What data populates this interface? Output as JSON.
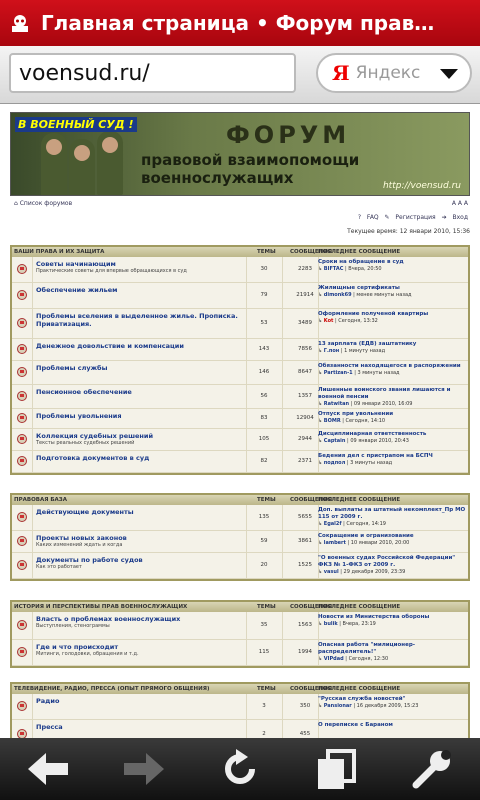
{
  "browser": {
    "tab_title": "Главная страница • Форум прав…",
    "url": "voensud.ru/",
    "search_logo": "Я",
    "search_engine": "Яндекс"
  },
  "banner": {
    "badge": "В ВОЕННЫЙ СУД !",
    "title": "ФОРУМ",
    "subtitle": "правовой взаимопомощи военнослужащих",
    "url": "http://voensud.ru"
  },
  "nav": {
    "index_link": "Список форумов",
    "aa": "A A A",
    "faq": "FAQ",
    "register": "Регистрация",
    "login": "Вход",
    "time": "Текущее время: 12 январи 2010, 15:36"
  },
  "cols": {
    "topics": "ТЕМЫ",
    "posts": "СООБЩЕНИЯ",
    "last": "ПОСЛЕДНЕЕ СООБЩЕНИЕ"
  },
  "categories": [
    {
      "name": "ВАШИ ПРАВА И ИХ ЗАЩИТА",
      "forums": [
        {
          "name": "Советы начинающим",
          "desc": "Практические советы для впервые обращающихся в суд",
          "topics": "30",
          "posts": "2283",
          "lt": "Сроки на обращение в суд",
          "lb_user": "BIFTAC",
          "lb_time": " | Вчера, 20:50"
        },
        {
          "name": "Обеспечение жильем",
          "desc": "",
          "topics": "79",
          "posts": "21914",
          "lt": "Жилищные сертификаты",
          "lb_user": "dimonk69",
          "lb_time": " | менее минуты назад"
        },
        {
          "name": "Проблемы вселения в выделенное жилье. Прописка. Приватизация.",
          "desc": "",
          "topics": "53",
          "posts": "3489",
          "lt": "Оформление полученой квартиры",
          "lb_user": "Kot",
          "lb_time": " | Сегодня, 13:32",
          "red": true
        },
        {
          "name": "Денежное довольствие и компенсации",
          "desc": "",
          "topics": "143",
          "posts": "7856",
          "lt": "13 зарплата (ЕДВ) заштатнику",
          "lb_user": "Г.пон",
          "lb_time": " | 1 минуту назад"
        },
        {
          "name": "Проблемы службы",
          "desc": "",
          "topics": "146",
          "posts": "8647",
          "lt": "Обязанности находящегося в распоряжении",
          "lb_user": "Partizan-1",
          "lb_time": " | 3 минуты назад"
        },
        {
          "name": "Пенсионное обеспечение",
          "desc": "",
          "topics": "56",
          "posts": "1357",
          "lt": "Лишенные воинского звания лишаются и военной пенсии",
          "lb_user": "Ratwitan",
          "lb_time": " | 09 январи 2010, 16:09"
        },
        {
          "name": "Проблемы увольнения",
          "desc": "",
          "topics": "83",
          "posts": "12904",
          "lt": "Отпуск при увольнении",
          "lb_user": "BOMR",
          "lb_time": " | Сегодня, 14:10"
        },
        {
          "name": "Коллекция судебных решений",
          "desc": "Тексты реальных судебных решений",
          "topics": "105",
          "posts": "2944",
          "lt": "Дисциплинарная ответственность",
          "lb_user": "Captain",
          "lb_time": " | 09 январи 2010, 20:43"
        },
        {
          "name": "Подготовка документов в суд",
          "desc": "",
          "topics": "82",
          "posts": "2371",
          "lt": "Бедения дел с пристрапом на БСПЧ",
          "lb_user": "подпол",
          "lb_time": " | 3 минуты назад"
        }
      ]
    },
    {
      "name": "ПРАВОВАЯ БАЗА",
      "forums": [
        {
          "name": "Действующие документы",
          "desc": "",
          "topics": "135",
          "posts": "5655",
          "lt": "Доп. выплаты за штатный некомплект_Пр МО 115 от 2009 г.",
          "lb_user": "Egal2f",
          "lb_time": " | Сегодня, 14:19"
        },
        {
          "name": "Проекты новых законов",
          "desc": "Каких изменений ждать и когда",
          "topics": "59",
          "posts": "3861",
          "lt": "Сокращение и огранизование",
          "lb_user": "lambert",
          "lb_time": " | 10 январи 2010, 20:00"
        },
        {
          "name": "Документы по работе судов",
          "desc": "Как это работает",
          "topics": "20",
          "posts": "1525",
          "lt": "\"О военных судах Российской Федерации\" ФКЗ № 1-ФКЗ от 2009 г.",
          "lb_user": "vasul",
          "lb_time": " | 29 декабря 2009, 23:39"
        }
      ]
    },
    {
      "name": "ИСТОРИЯ И ПЕРСПЕКТИВЫ ПРАВ ВОЕННОСЛУЖАЩИХ",
      "forums": [
        {
          "name": "Власть о проблемах военнослужащих",
          "desc": "Выступления, стенограммы",
          "topics": "35",
          "posts": "1563",
          "lt": "Новости из Министерства обороны",
          "lb_user": "bulik",
          "lb_time": " | Вчера, 23:19"
        },
        {
          "name": "Где и что происходит",
          "desc": "Митинги, голодовки, обращения и т.д.",
          "topics": "115",
          "posts": "1994",
          "lt": "Опасная работа \"милиционер-распределитель!\"",
          "lb_user": "VIPdad",
          "lb_time": " | Сегодня, 12:30"
        }
      ]
    },
    {
      "name": "ТЕЛЕВИДЕНИЕ, РАДИО, ПРЕССА (ОПЫТ ПРЯМОГО ОБЩЕНИЯ)",
      "forums": [
        {
          "name": "Радио",
          "desc": "",
          "topics": "3",
          "posts": "350",
          "lt": "\"Русская служба новостей\"",
          "lb_user": "Pansionar",
          "lb_time": " | 16 декабря 2009, 15:23"
        },
        {
          "name": "Пресса",
          "desc": "",
          "topics": "2",
          "posts": "455",
          "lt": "О переписке с Бараном",
          "lb_user": "",
          "lb_time": ""
        }
      ]
    }
  ]
}
